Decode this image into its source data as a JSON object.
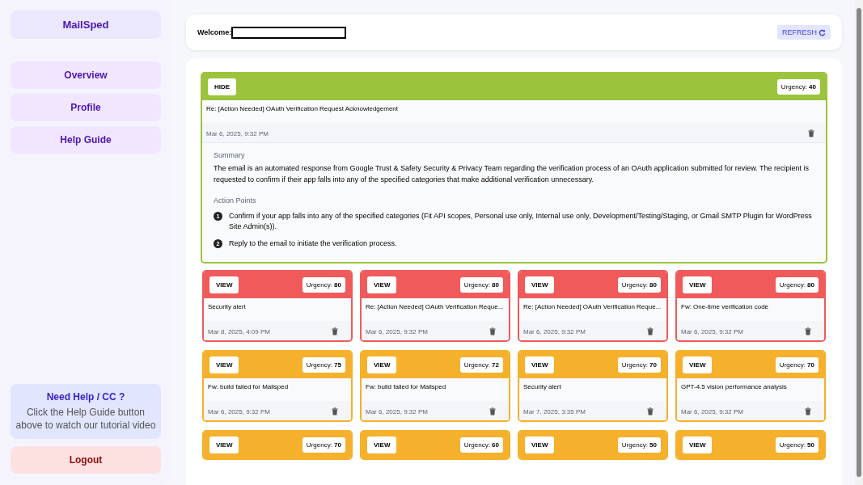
{
  "sidebar": {
    "brand": "MailSped",
    "nav": [
      {
        "label": "Overview"
      },
      {
        "label": "Profile"
      },
      {
        "label": "Help Guide"
      }
    ],
    "help": {
      "title": "Need Help / CC ?",
      "text": "Click the Help Guide button above to watch our tutorial video"
    },
    "logout": "Logout"
  },
  "header": {
    "welcome": "Welcome:",
    "refresh": "REFRESH"
  },
  "featured": {
    "button": "HIDE",
    "urgency_label": "Urgency:",
    "urgency": "40",
    "color": "#9bc43c",
    "subject": "Re: [Action Needed] OAuth Verification Request Acknowledgement",
    "date": "Mar 6, 2025, 9:32 PM",
    "summary_title": "Summary",
    "summary": "The email is an automated response from Google Trust & Safety Security & Privacy Team regarding the verification process of an OAuth application submitted for review. The recipient is requested to confirm if their app falls into any of the specified categories that make additional verification unnecessary.",
    "actions_title": "Action Points",
    "actions": [
      {
        "num": "1",
        "text": "Confirm if your app falls into any of the specified categories (Fit API scopes, Personal use only, Internal use only, Development/Testing/Staging, or Gmail SMTP Plugin for WordPress Site Admin(s))."
      },
      {
        "num": "2",
        "text": "Reply to the email to initiate the verification process."
      }
    ]
  },
  "cards": [
    {
      "button": "VIEW",
      "urgency_label": "Urgency:",
      "urgency": "80",
      "color": "#f05a5a",
      "subject": "Security alert",
      "date": "Mar 8, 2025, 4:09 PM"
    },
    {
      "button": "VIEW",
      "urgency_label": "Urgency:",
      "urgency": "80",
      "color": "#f05a5a",
      "subject": "Re: [Action Needed] OAuth Verification Reque...",
      "date": "Mar 6, 2025, 9:32 PM"
    },
    {
      "button": "VIEW",
      "urgency_label": "Urgency:",
      "urgency": "80",
      "color": "#f05a5a",
      "subject": "Re: [Action Needed] OAuth Verification Reque...",
      "date": "Mar 6, 2025, 9:32 PM"
    },
    {
      "button": "VIEW",
      "urgency_label": "Urgency:",
      "urgency": "80",
      "color": "#f05a5a",
      "subject": "Fw: One-time verification code",
      "date": "Mar 6, 2025, 9:32 PM"
    },
    {
      "button": "VIEW",
      "urgency_label": "Urgency:",
      "urgency": "75",
      "color": "#f5b02c",
      "subject": "Fw: build failed for Mailsped",
      "date": "Mar 6, 2025, 9:32 PM"
    },
    {
      "button": "VIEW",
      "urgency_label": "Urgency:",
      "urgency": "72",
      "color": "#f5b02c",
      "subject": "Fw: build failed for Mailsped",
      "date": "Mar 6, 2025, 9:32 PM"
    },
    {
      "button": "VIEW",
      "urgency_label": "Urgency:",
      "urgency": "70",
      "color": "#f5b02c",
      "subject": "Security alert",
      "date": "Mar 7, 2025, 3:35 PM"
    },
    {
      "button": "VIEW",
      "urgency_label": "Urgency:",
      "urgency": "70",
      "color": "#f5b02c",
      "subject": "GPT-4.5 vision performance analysis",
      "date": "Mar 6, 2025, 9:32 PM"
    },
    {
      "button": "VIEW",
      "urgency_label": "Urgency:",
      "urgency": "70",
      "color": "#f5b02c"
    },
    {
      "button": "VIEW",
      "urgency_label": "Urgency:",
      "urgency": "60",
      "color": "#f5b02c"
    },
    {
      "button": "VIEW",
      "urgency_label": "Urgency:",
      "urgency": "50",
      "color": "#f5b02c"
    },
    {
      "button": "VIEW",
      "urgency_label": "Urgency:",
      "urgency": "50",
      "color": "#f5b02c"
    }
  ]
}
